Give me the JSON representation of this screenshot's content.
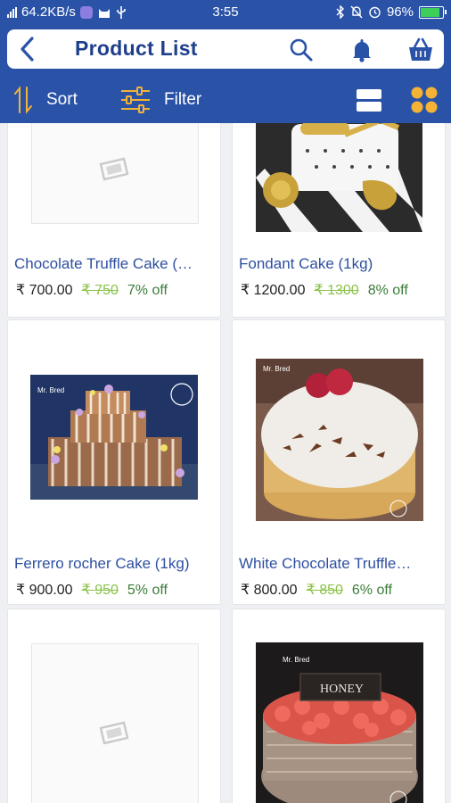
{
  "status_bar": {
    "network_speed": "64.2KB/s",
    "time": "3:55",
    "battery_percent": "96%",
    "battery_level": 0.96
  },
  "header": {
    "title": "Product List",
    "back_icon": "arrow-left-icon",
    "search_icon": "search-icon",
    "notification_icon": "bell-icon",
    "cart_icon": "basket-icon"
  },
  "toolbar": {
    "sort_label": "Sort",
    "filter_label": "Filter",
    "list_view_icon": "list-view-icon",
    "grid_view_icon": "grid-view-icon"
  },
  "colors": {
    "primary": "#2a53a8",
    "accent": "#f5b335",
    "product_name": "#2e4fa0",
    "mrp": "#8bc34a",
    "discount": "#3a7d3a"
  },
  "products": [
    {
      "name": "Chocolate Truffle Cake (…",
      "price": "₹ 700.00",
      "mrp": "₹ 750",
      "discount": "7% off",
      "image": "placeholder"
    },
    {
      "name": "Fondant Cake (1kg)",
      "price": "₹ 1200.00",
      "mrp": "₹ 1300",
      "discount": "8% off",
      "image": "fondant"
    },
    {
      "name": "Ferrero rocher Cake (1kg)",
      "price": "₹ 900.00",
      "mrp": "₹ 950",
      "discount": "5% off",
      "image": "ferrero",
      "watermark": "Mr. Bred"
    },
    {
      "name": "White Chocolate Truffle…",
      "price": "₹ 800.00",
      "mrp": "₹ 850",
      "discount": "6% off",
      "image": "white-truffle",
      "watermark": "Mr. Bred"
    },
    {
      "name": "",
      "price": "",
      "mrp": "",
      "discount": "",
      "image": "placeholder"
    },
    {
      "name": "",
      "price": "",
      "mrp": "",
      "discount": "",
      "image": "honey",
      "watermark": "Mr. Bred",
      "cake_text": "HONEY"
    }
  ]
}
